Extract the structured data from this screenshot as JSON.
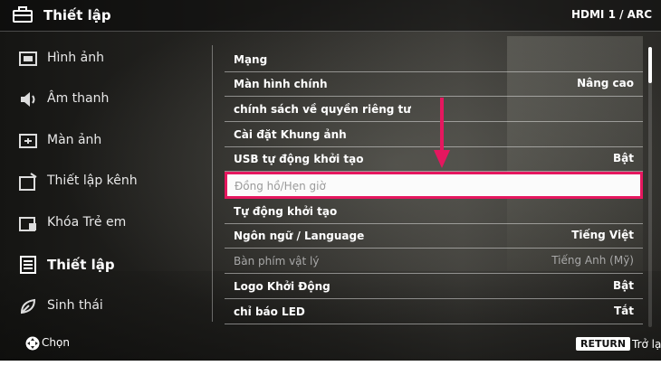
{
  "header": {
    "title": "Thiết lập",
    "input": "HDMI 1 / ARC"
  },
  "sidebar": {
    "items": [
      {
        "label": "Hình ảnh",
        "icon": "picture-icon"
      },
      {
        "label": "Âm thanh",
        "icon": "speaker-icon"
      },
      {
        "label": "Màn ảnh",
        "icon": "screen-icon"
      },
      {
        "label": "Thiết lập kênh",
        "icon": "channel-setup-icon"
      },
      {
        "label": "Khóa Trẻ em",
        "icon": "lock-icon"
      },
      {
        "label": "Thiết lập",
        "icon": "settings-list-icon",
        "active": true
      },
      {
        "label": "Sinh thái",
        "icon": "eco-leaf-icon"
      }
    ]
  },
  "settings": {
    "rows": [
      {
        "label": "Mạng",
        "value": ""
      },
      {
        "label": "Màn hình chính",
        "value": "Nâng cao"
      },
      {
        "label": "chính sách về quyền riêng tư",
        "value": ""
      },
      {
        "label": "Cài đặt Khung ảnh",
        "value": ""
      },
      {
        "label": "USB tự động khởi tạo",
        "value": "Bật"
      },
      {
        "label": "Đồng hồ/Hẹn giờ",
        "value": ""
      },
      {
        "label": "Tự động khởi tạo",
        "value": ""
      },
      {
        "label": "Ngôn ngữ / Language",
        "value": "Tiếng Việt"
      },
      {
        "label": "Bàn phím vật lý",
        "value": "Tiếng Anh (Mỹ)"
      },
      {
        "label": "Logo Khởi Động",
        "value": "Bật"
      },
      {
        "label": "chỉ báo LED",
        "value": "Tắt"
      }
    ]
  },
  "footer": {
    "select": "Chọn",
    "return_key": "RETURN",
    "return_label": "Trở lại"
  },
  "colors": {
    "highlight_border": "#e5175f",
    "arrow": "#e5175f"
  }
}
